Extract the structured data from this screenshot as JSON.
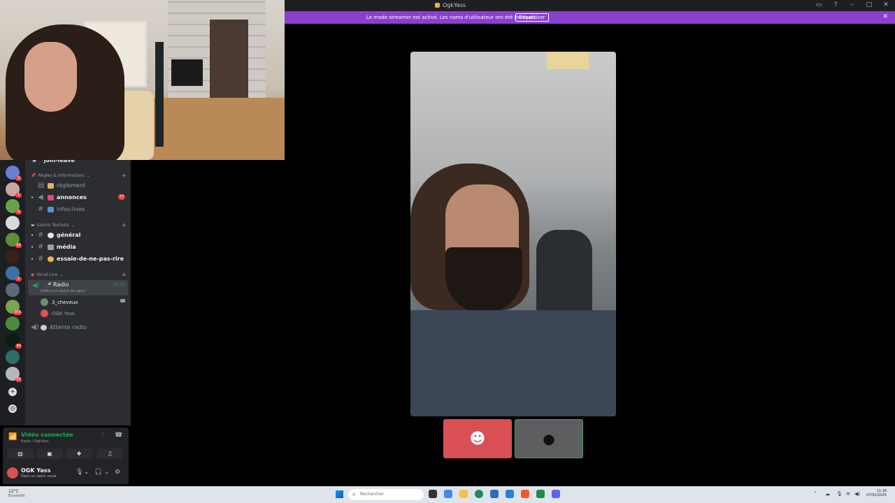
{
  "window": {
    "title": "OgkYass",
    "controls": [
      "inbox-icon",
      "help-icon",
      "minimize-icon",
      "maximize-icon",
      "close-icon"
    ]
  },
  "banner": {
    "message": "Le mode streamer est activé. Les noms d'utilisateur ont été tronqués.",
    "button": "Désactiver",
    "close": "✕",
    "color": "#8a3fd1"
  },
  "servers": [
    {
      "badge": "3",
      "color": "#6a7fd3"
    },
    {
      "badge": "1",
      "color": "#c9a6a0"
    },
    {
      "badge": "4",
      "color": "#66a34a"
    },
    {
      "badge": "",
      "color": "#d7dadd"
    },
    {
      "badge": "59",
      "color": "#5b8f3a"
    },
    {
      "badge": "",
      "color": "#3a1f1a"
    },
    {
      "badge": "1",
      "color": "#3d6fa8"
    },
    {
      "badge": "",
      "color": "#5a6a78"
    },
    {
      "badge": "355",
      "color": "#79a64f"
    },
    {
      "badge": "",
      "color": "#4d8b3f"
    },
    {
      "badge": "40",
      "color": "#0e1a12"
    },
    {
      "badge": "",
      "color": "#2d6e6a"
    },
    {
      "badge": "93",
      "color": "#b3b8c0"
    }
  ],
  "sidebar": {
    "cut_channel": "join-leave",
    "categories": {
      "rules": "Règles & Informations",
      "text": "Salons Textuels",
      "voice": "Vocal Live"
    },
    "channels": [
      {
        "name": "règlement",
        "style": "dim"
      },
      {
        "name": "annonces",
        "style": "bold",
        "count": "77"
      },
      {
        "name": "infos-lives",
        "style": "dim"
      },
      {
        "name": "général",
        "style": "bold"
      },
      {
        "name": "média",
        "style": "bold"
      },
      {
        "name": "essaie-de-ne-pas-rire",
        "style": "bold"
      }
    ],
    "voice": {
      "channel": "Radio",
      "timer": "21:31",
      "status_prompt": "Définir un statut de salon",
      "members": [
        "3_cheveux",
        "OGK Yass"
      ],
      "waiting": "Attente radio"
    }
  },
  "voice_panel": {
    "status": "Vidéo connectée",
    "location": "Radio / OgkYass"
  },
  "user_panel": {
    "name": "OGK Yass",
    "status": "Dans un salon vocal"
  },
  "taskbar": {
    "weather_temp": "12°C",
    "weather_desc": "Ensoleillé",
    "search_placeholder": "Rechercher",
    "time": "11:18",
    "date": "07/02/2025"
  },
  "colors": {
    "green": "#23a55a",
    "red": "#f23f43",
    "discord_tile": "#d94f55"
  }
}
